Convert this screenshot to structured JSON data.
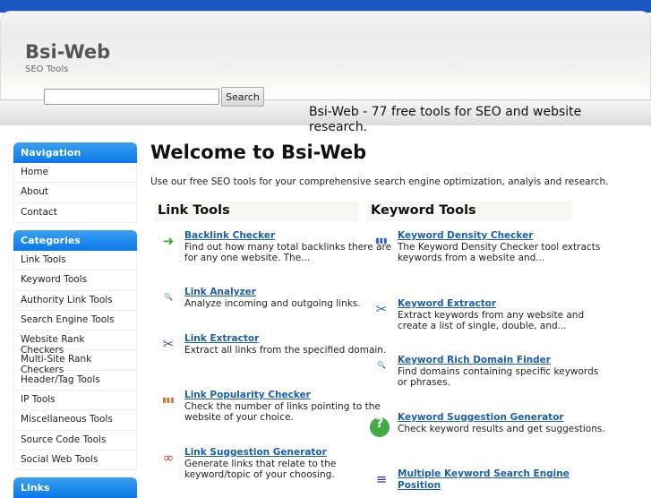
{
  "header": {
    "title": "Bsi-Web",
    "subtitle": "SEO Tools",
    "search_placeholder": "",
    "search_button": "Search",
    "tagline": "Bsi-Web - 77 free tools for SEO and website research."
  },
  "sidebar": {
    "navigation": {
      "title": "Navigation",
      "items": [
        "Home",
        "About",
        "Contact"
      ]
    },
    "categories": {
      "title": "Categories",
      "items": [
        "Link Tools",
        "Keyword Tools",
        "Authority Link Tools",
        "Search Engine Tools",
        "Website Rank Checkers",
        "Multi-Site Rank Checkers",
        "Header/Tag Tools",
        "IP Tools",
        "Miscellaneous Tools",
        "Source Code Tools",
        "Social Web Tools"
      ]
    },
    "links": {
      "title": "Links"
    }
  },
  "main": {
    "title": "Welcome to Bsi-Web",
    "intro": "Use our free SEO tools for your comprehensive search engine optimization, analyis and research.",
    "link_tools": {
      "title": "Link Tools",
      "items": [
        {
          "name": "Backlink Checker",
          "desc": "Find out how many total backlinks there are for any one website. The...",
          "icon": "backlink-icon"
        },
        {
          "name": "Link Analyzer",
          "desc": "Analyze incoming and outgoing links.",
          "icon": "magnifier-icon"
        },
        {
          "name": "Link Extractor",
          "desc": "Extract all links from the specified domain.",
          "icon": "scissors-icon"
        },
        {
          "name": "Link Popularity Checker",
          "desc": "Check the number of links pointing to the website of your choice.",
          "icon": "bar-chart-icon"
        },
        {
          "name": "Link Suggestion Generator",
          "desc": "Generate links that relate to the keyword/topic of your choosing.",
          "icon": "chain-links-icon"
        }
      ]
    },
    "keyword_tools": {
      "title": "Keyword Tools",
      "items": [
        {
          "name": "Keyword Density Checker",
          "desc": "The Keyword Density Checker tool extracts keywords from a website and...",
          "icon": "keyword-chart-icon"
        },
        {
          "name": "Keyword Extractor",
          "desc": "Extract keywords from any website and create a list of single, double, and...",
          "icon": "keyword-scissors-icon"
        },
        {
          "name": "Keyword Rich Domain Finder",
          "desc": "Find domains containing specific keywords or phrases.",
          "icon": "domain-magnifier-icon"
        },
        {
          "name": "Keyword Suggestion Generator",
          "desc": "Check keyword results and get suggestions.",
          "icon": "question-icon"
        },
        {
          "name": "Multiple Keyword Search Engine Position",
          "desc": "",
          "icon": "word-list-icon"
        }
      ]
    }
  }
}
